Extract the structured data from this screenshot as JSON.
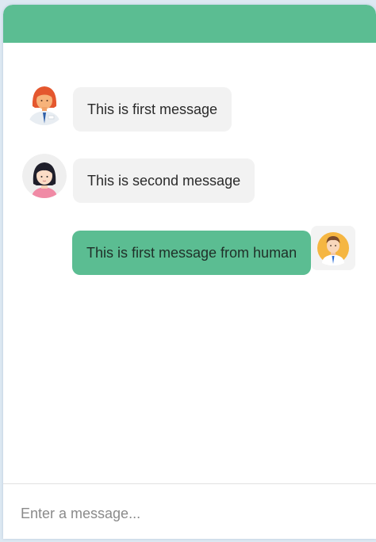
{
  "header": {
    "title": "",
    "color": "#5bbd92"
  },
  "messages": [
    {
      "sender": "bot",
      "avatar_icon": "woman-orange-hair-icon",
      "text": "This is first message"
    },
    {
      "sender": "bot",
      "avatar_icon": "woman-black-hair-icon",
      "text": "This is second message"
    },
    {
      "sender": "human",
      "avatar_icon": "man-avatar-icon",
      "text": "This is first message from human"
    }
  ],
  "input": {
    "placeholder": "Enter a message...",
    "value": ""
  },
  "colors": {
    "accent": "#5bbd92",
    "bot_bubble": "#f2f2f2",
    "page_background": "#dde8f2"
  }
}
